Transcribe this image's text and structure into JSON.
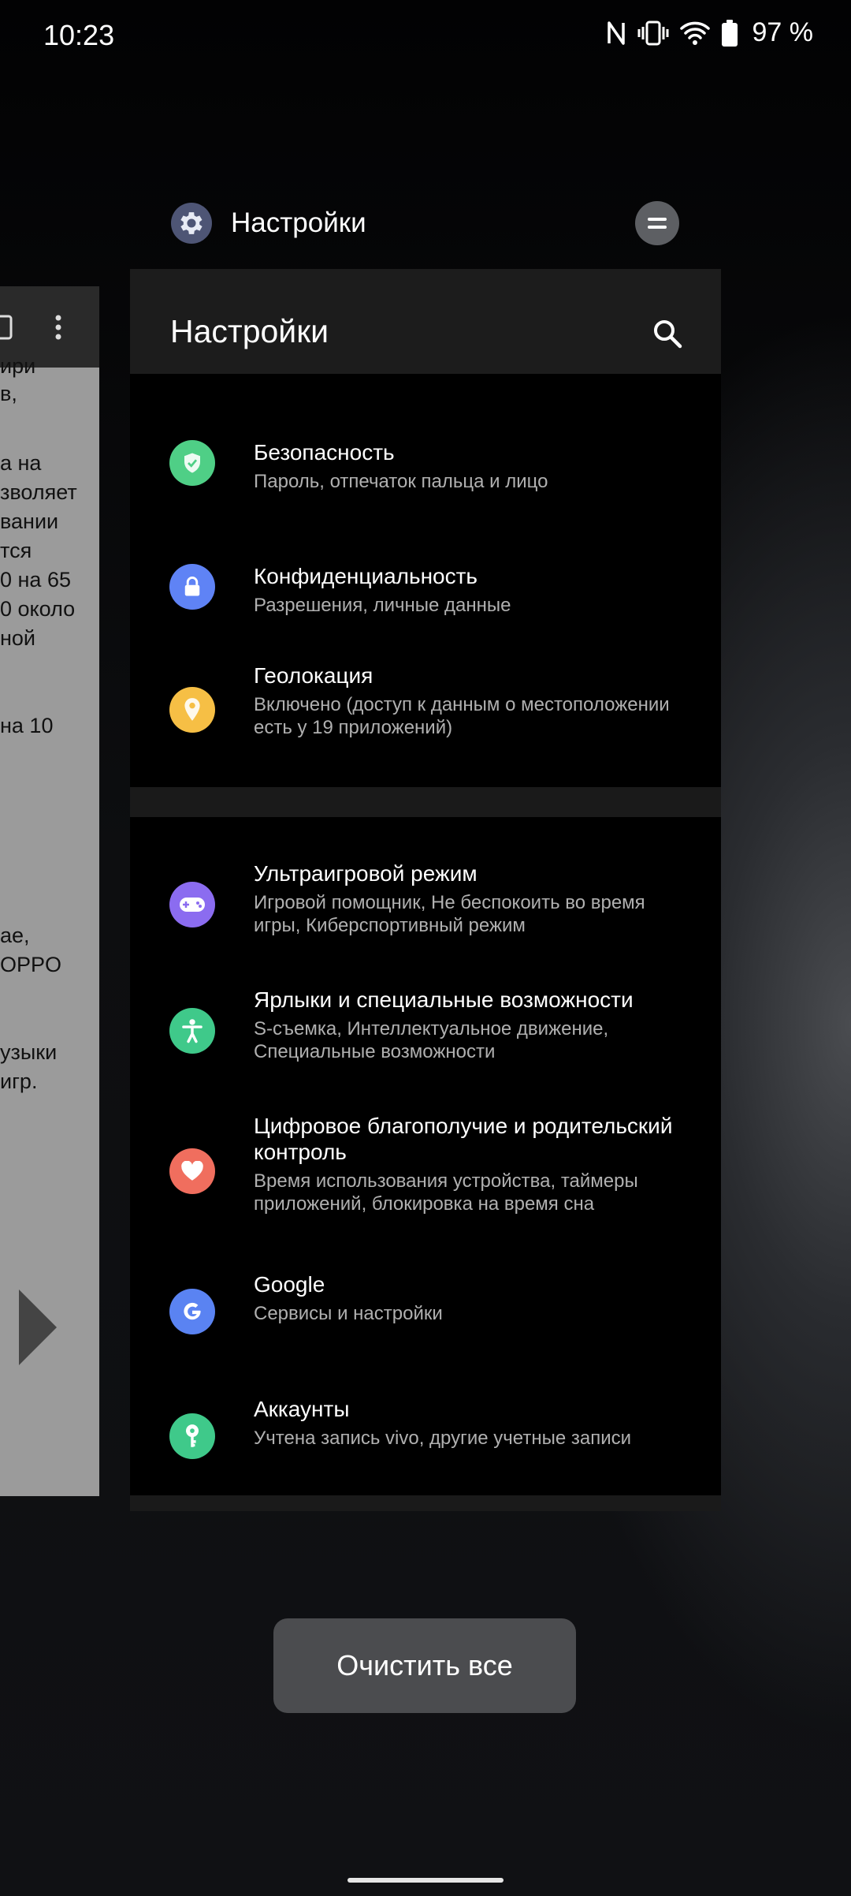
{
  "status_bar": {
    "time": "10:23",
    "battery": "97 %",
    "icons": [
      "nfc-icon",
      "vibrate-icon",
      "wifi-icon",
      "battery-icon"
    ]
  },
  "background_card": {
    "text_fragments": [
      "ири",
      "в,",
      "а на",
      "зволяет",
      "вании",
      "тся",
      "0 на 65",
      "0 около",
      "ной",
      "на 10",
      "ае,",
      "OPPO",
      "узыки",
      "игр."
    ]
  },
  "app_header": {
    "title": "Настройки",
    "icon": "gear-icon"
  },
  "card": {
    "title": "Настройки",
    "group1": [
      {
        "title": "Безопасность",
        "subtitle": "Пароль, отпечаток пальца и лицо",
        "color": "#4fcf86",
        "icon": "shield-icon"
      },
      {
        "title": "Конфиденциальность",
        "subtitle": "Разрешения, личные данные",
        "color": "#5f83f5",
        "icon": "lock-icon"
      },
      {
        "title": "Геолокация",
        "subtitle": "Включено (доступ к данным о местоположении есть у 19 приложений)",
        "color": "#f6bf45",
        "icon": "location-pin-icon"
      }
    ],
    "group2": [
      {
        "title": "Ультраигровой режим",
        "subtitle": "Игровой помощник, Не беспокоить во время игры, Киберспортивный режим",
        "color": "#8b6cf0",
        "icon": "gamepad-icon"
      },
      {
        "title": "Ярлыки и специальные возможности",
        "subtitle": "S-съемка, Интеллектуальное движение, Специальные возможности",
        "color": "#3fc98a",
        "icon": "accessibility-icon"
      },
      {
        "title": "Цифровое благополучие и родительский контроль",
        "subtitle": "Время использования устройства, таймеры приложений, блокировка на время сна",
        "color": "#f06e5e",
        "icon": "heart-icon"
      },
      {
        "title": "Google",
        "subtitle": "Сервисы и настройки",
        "color": "#5a83f2",
        "icon": "google-g-icon"
      },
      {
        "title": "Аккаунты",
        "subtitle": "Учтена запись vivo, другие учетные записи",
        "color": "#3fc98a",
        "icon": "key-icon"
      }
    ]
  },
  "clear_all_label": "Очистить все"
}
